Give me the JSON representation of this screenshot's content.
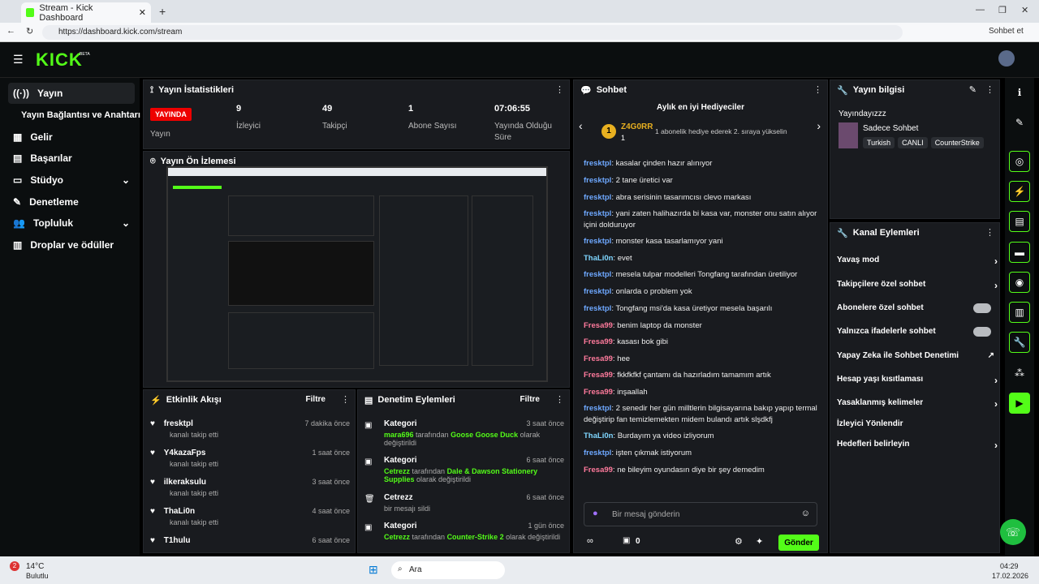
{
  "browser": {
    "tab_title": "Stream - Kick Dashboard",
    "url": "https://dashboard.kick.com/stream",
    "profile": "Sohbet et"
  },
  "brand": {
    "logo": "KICK",
    "beta": "BETA",
    "accent": "#53fc18"
  },
  "sidebar": {
    "items": [
      {
        "label": "Yayın",
        "icon": "broadcast-icon"
      },
      {
        "label": "Yayın Bağlantısı ve Anahtarı",
        "icon": ""
      },
      {
        "label": "Gelir",
        "icon": "revenue-icon"
      },
      {
        "label": "Başarılar",
        "icon": "achievements-icon"
      },
      {
        "label": "Stüdyo",
        "icon": "studio-icon"
      },
      {
        "label": "Denetleme",
        "icon": "moderation-icon"
      },
      {
        "label": "Topluluk",
        "icon": "community-icon"
      },
      {
        "label": "Droplar ve ödüller",
        "icon": "drops-icon"
      }
    ]
  },
  "stats": {
    "title": "Yayın İstatistikleri",
    "live_badge": "YAYINDA",
    "items": [
      {
        "value": "",
        "label": "Yayın"
      },
      {
        "value": "9",
        "label": "İzleyici"
      },
      {
        "value": "49",
        "label": "Takipçi"
      },
      {
        "value": "1",
        "label": "Abone Sayısı"
      },
      {
        "value": "07:06:55",
        "label": "Yayında Olduğu Süre"
      }
    ]
  },
  "preview": {
    "title": "Yayın Ön İzlemesi"
  },
  "activity": {
    "title": "Etkinlik Akışı",
    "filter": "Filtre",
    "items": [
      {
        "user": "fresktpl",
        "action": "kanalı takip etti",
        "time": "7 dakika önce"
      },
      {
        "user": "Y4kazaFps",
        "action": "kanalı takip etti",
        "time": "1 saat önce"
      },
      {
        "user": "ilkeraksulu",
        "action": "kanalı takip etti",
        "time": "3 saat önce"
      },
      {
        "user": "ThaLi0n",
        "action": "kanalı takip etti",
        "time": "4 saat önce"
      },
      {
        "user": "T1hulu",
        "action": "",
        "time": "6 saat önce"
      }
    ]
  },
  "moderation": {
    "title": "Denetim Eylemleri",
    "filter": "Filtre",
    "items": [
      {
        "title": "Kategori",
        "who": "mara696",
        "mid": " tarafından ",
        "what": "Goose Goose Duck",
        "tail": " olarak değiştirildi",
        "time": "3 saat önce"
      },
      {
        "title": "Kategori",
        "who": "Cetrezz",
        "mid": " tarafından ",
        "what": "Dale & Dawson Stationery Supplies",
        "tail": " olarak değiştirildi",
        "time": "6 saat önce"
      },
      {
        "title": "Cetrezz",
        "who": "",
        "mid": "bir mesajı sildi",
        "what": "",
        "tail": "",
        "time": "6 saat önce"
      },
      {
        "title": "Kategori",
        "who": "Cetrezz",
        "mid": " tarafından ",
        "what": "Counter-Strike 2",
        "tail": " olarak değiştirildi",
        "time": "1 gün önce"
      }
    ]
  },
  "chat": {
    "title": "Sohbet",
    "gifters_title": "Aylık en iyi Hediyeciler",
    "top_user": "Z4G0RR",
    "top_count": "1",
    "rank": "1",
    "promo": "1 abonelik hediye ederek 2. sıraya yükselin",
    "placeholder": "Bir mesaj gönderin",
    "send": "Gönder",
    "count": "0",
    "messages": [
      {
        "user": "fresktpl",
        "text": "kasalar çinden hazır alınıyor",
        "color": "#6ea8ff"
      },
      {
        "user": "fresktpl",
        "text": "2 tane üretici var",
        "color": "#6ea8ff"
      },
      {
        "user": "fresktpl",
        "text": "abra serisinin tasarımcısı clevo markası",
        "color": "#6ea8ff"
      },
      {
        "user": "fresktpl",
        "text": "yani zaten halihazırda bi kasa var, monster onu satın alıyor içini dolduruyor",
        "color": "#6ea8ff"
      },
      {
        "user": "fresktpl",
        "text": "monster kasa tasarlamıyor yani",
        "color": "#6ea8ff"
      },
      {
        "user": "ThaLi0n",
        "text": "evet",
        "color": "#7fd6ff"
      },
      {
        "user": "fresktpl",
        "text": "mesela tulpar modelleri Tongfang tarafından üretiliyor",
        "color": "#6ea8ff"
      },
      {
        "user": "fresktpl",
        "text": "onlarda o problem yok",
        "color": "#6ea8ff"
      },
      {
        "user": "fresktpl",
        "text": "Tongfang msi'da kasa üretiyor mesela başarılı",
        "color": "#6ea8ff"
      },
      {
        "user": "Fresa99",
        "text": "benim laptop da monster",
        "color": "#ff7a9c"
      },
      {
        "user": "Fresa99",
        "text": "kasası bok gibi",
        "color": "#ff7a9c"
      },
      {
        "user": "Fresa99",
        "text": "hee",
        "color": "#ff7a9c"
      },
      {
        "user": "Fresa99",
        "text": "fkkfkfkf çantamı da hazırladım tamamım artık",
        "color": "#ff7a9c"
      },
      {
        "user": "Fresa99",
        "text": "inşaallah",
        "color": "#ff7a9c"
      },
      {
        "user": "fresktpl",
        "text": "2 senedir her gün milltlerin bilgisayarına bakıp yapıp termal değiştirip fan temizlemekten midem bulandı artık slşdkfj",
        "color": "#6ea8ff"
      },
      {
        "user": "ThaLi0n",
        "text": "Burdayım ya video izliyorum",
        "color": "#7fd6ff"
      },
      {
        "user": "fresktpl",
        "text": "işten çıkmak istiyorum",
        "color": "#6ea8ff"
      },
      {
        "user": "Fresa99",
        "text": "ne bileyim oyundasın diye bir şey demedim",
        "color": "#ff7a9c"
      }
    ]
  },
  "info": {
    "title": "Yayın bilgisi",
    "stream_title": "Yayındayızzz",
    "mode": "Sadece Sohbet",
    "tags": [
      "Turkish",
      "CANLI",
      "CounterStrike"
    ]
  },
  "actions": {
    "title": "Kanal Eylemleri",
    "items": [
      {
        "label": "Yavaş mod",
        "ctrl": "arrow"
      },
      {
        "label": "Takipçilere özel sohbet",
        "ctrl": "arrow"
      },
      {
        "label": "Abonelere özel sohbet",
        "ctrl": "toggle"
      },
      {
        "label": "Yalnızca ifadelerle sohbet",
        "ctrl": "toggle"
      },
      {
        "label": "Yapay Zeka ile Sohbet Denetimi",
        "ctrl": "external"
      },
      {
        "label": "Hesap yaşı kısıtlaması",
        "ctrl": "arrow"
      },
      {
        "label": "Yasaklanmış kelimeler",
        "ctrl": "arrow"
      },
      {
        "label": "İzleyici Yönlendir",
        "ctrl": ""
      },
      {
        "label": "Hedefleri belirleyin",
        "ctrl": "arrow"
      }
    ]
  },
  "taskbar": {
    "temp": "14°C",
    "weather": "Bulutlu",
    "search": "Ara",
    "time": "04:29",
    "date": "17.02.2026",
    "badge": "2"
  }
}
